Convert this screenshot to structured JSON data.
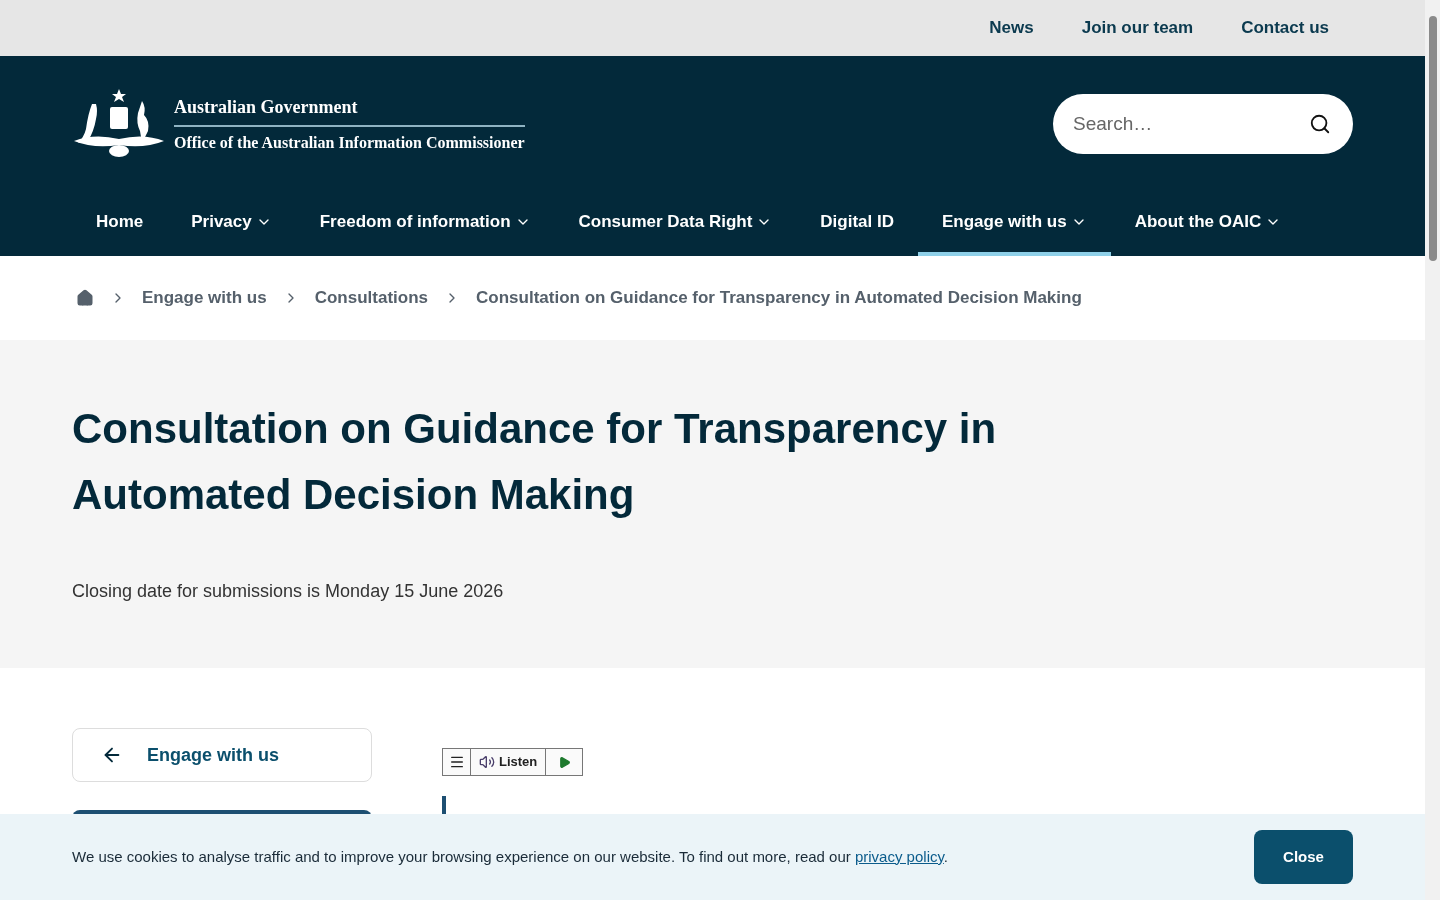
{
  "top_links": [
    "News",
    "Join our team",
    "Contact us"
  ],
  "logo": {
    "line_1": "Australian Government",
    "line_2": "Office of the Australian Information Commissioner"
  },
  "search": {
    "placeholder": "Search…"
  },
  "nav": [
    {
      "label": "Home",
      "dropdown": false,
      "selected": false
    },
    {
      "label": "Privacy",
      "dropdown": true,
      "selected": false
    },
    {
      "label": "Freedom of information",
      "dropdown": true,
      "selected": false
    },
    {
      "label": "Consumer Data Right",
      "dropdown": true,
      "selected": false
    },
    {
      "label": "Digital ID",
      "dropdown": false,
      "selected": false
    },
    {
      "label": "Engage with us",
      "dropdown": true,
      "selected": true
    },
    {
      "label": "About the OAIC",
      "dropdown": true,
      "selected": false
    }
  ],
  "breadcrumb": [
    "Engage with us",
    "Consultations",
    "Consultation on Guidance for Transparency in Automated Decision Making"
  ],
  "page": {
    "title": "Consultation on Guidance for Transparency in Automated Decision Making",
    "subtitle": "Closing date for submissions is Monday 15 June 2026"
  },
  "back_link": "Engage with us",
  "listen_label": "Listen",
  "cookie": {
    "text": "We use cookies to analyse traffic and to improve your browsing experience on our website. To find out more, read our ",
    "link": "privacy policy",
    "after": ".",
    "button": "Close"
  }
}
